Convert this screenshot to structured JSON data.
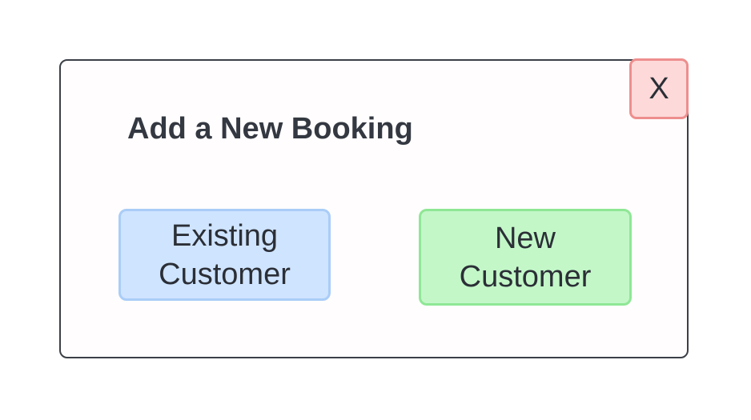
{
  "dialog": {
    "title": "Add a New Booking",
    "close_label": "X",
    "buttons": {
      "existing_customer": {
        "line1": "Existing",
        "line2": "Customer"
      },
      "new_customer": {
        "line1": "New",
        "line2": "Customer"
      }
    }
  },
  "colors": {
    "close_fill": "#fdd9d9",
    "close_border": "#ee8e8e",
    "existing_fill": "#cfe4ff",
    "existing_border": "#a9cdf7",
    "new_fill": "#c3f7c8",
    "new_border": "#8fe796",
    "text": "#2b2f36",
    "dialog_border": "#3b3f46"
  }
}
